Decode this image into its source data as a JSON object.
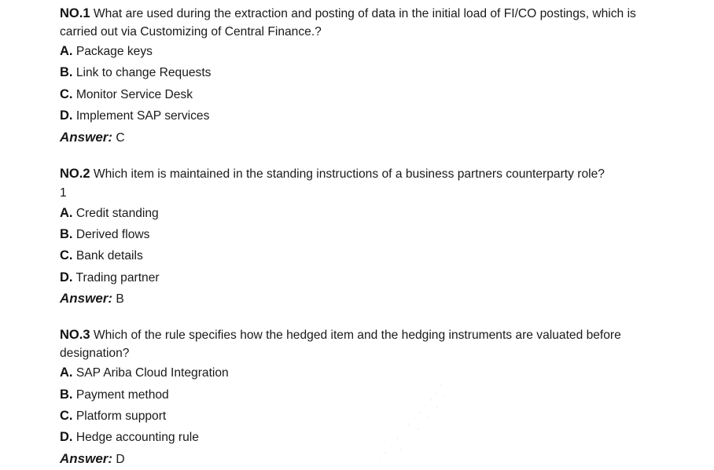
{
  "questions": [
    {
      "number": "NO.1",
      "text": " What are used during the extraction and posting of data in the initial load of FI/CO postings, which is carried out via Customizing of Central Finance.?",
      "extra": "",
      "options": [
        {
          "letter": "A.",
          "text": " Package keys"
        },
        {
          "letter": "B.",
          "text": " Link to change Requests"
        },
        {
          "letter": "C.",
          "text": " Monitor Service Desk"
        },
        {
          "letter": "D.",
          "text": " Implement SAP services"
        }
      ],
      "answer_label": "Answer:",
      "answer": " C"
    },
    {
      "number": "NO.2",
      "text": " Which item is maintained in the standing instructions of a business partners counterparty role?",
      "extra": "1",
      "options": [
        {
          "letter": "A.",
          "text": " Credit standing"
        },
        {
          "letter": "B.",
          "text": " Derived flows"
        },
        {
          "letter": "C.",
          "text": " Bank details"
        },
        {
          "letter": "D.",
          "text": " Trading partner"
        }
      ],
      "answer_label": "Answer:",
      "answer": " B"
    },
    {
      "number": "NO.3",
      "text": " Which of the rule specifies how the hedged item and the hedging instruments are valuated before designation?",
      "extra": "",
      "options": [
        {
          "letter": "A.",
          "text": " SAP Ariba Cloud Integration"
        },
        {
          "letter": "B.",
          "text": " Payment method"
        },
        {
          "letter": "C.",
          "text": " Platform support"
        },
        {
          "letter": "D.",
          "text": " Hedge accounting rule"
        }
      ],
      "answer_label": "Answer:",
      "answer": " D"
    }
  ]
}
